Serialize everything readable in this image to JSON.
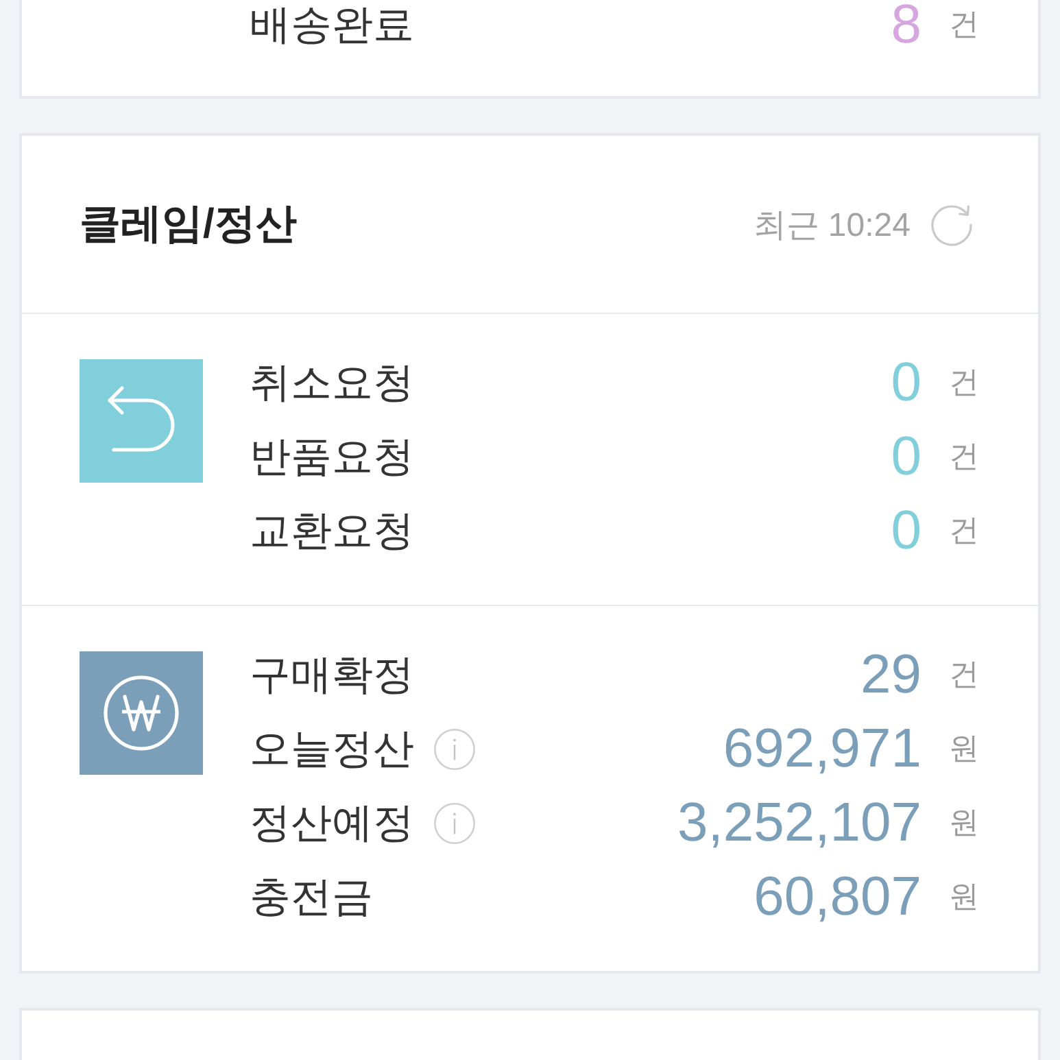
{
  "cards": [
    {
      "kind": "plain",
      "sections": [
        {
          "kind": "delivery",
          "color": "#d5a6e0",
          "rows": [
            {
              "label": "배송완료",
              "info": false,
              "value": "8",
              "unit": "건"
            }
          ]
        }
      ]
    },
    {
      "kind": "titled",
      "title": "클레임/정산",
      "updated": "최근 10:24",
      "sections": [
        {
          "kind": "claim",
          "color": "#80cfda",
          "rows": [
            {
              "label": "취소요청",
              "info": false,
              "value": "0",
              "unit": "건"
            },
            {
              "label": "반품요청",
              "info": false,
              "value": "0",
              "unit": "건"
            },
            {
              "label": "교환요청",
              "info": false,
              "value": "0",
              "unit": "건"
            }
          ]
        },
        {
          "kind": "settlement",
          "color": "#7b9eb9",
          "rows": [
            {
              "label": "구매확정",
              "info": false,
              "value": "29",
              "unit": "건"
            },
            {
              "label": "오늘정산",
              "info": true,
              "value": "692,971",
              "unit": "원"
            },
            {
              "label": "정산예정",
              "info": true,
              "value": "3,252,107",
              "unit": "원"
            },
            {
              "label": "충전금",
              "info": false,
              "value": "60,807",
              "unit": "원"
            }
          ]
        }
      ]
    },
    {
      "kind": "plain"
    }
  ]
}
